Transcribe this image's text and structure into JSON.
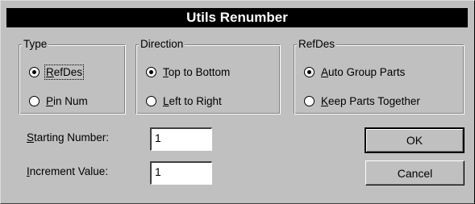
{
  "dialog": {
    "title": "Utils Renumber"
  },
  "type_group": {
    "legend": "Type",
    "options": [
      {
        "pre": "",
        "key": "R",
        "post": "efDes",
        "selected": true
      },
      {
        "pre": "",
        "key": "P",
        "post": "in Num",
        "selected": false
      }
    ]
  },
  "direction_group": {
    "legend": "Direction",
    "options": [
      {
        "pre": "",
        "key": "T",
        "post": "op to Bottom",
        "selected": true
      },
      {
        "pre": "",
        "key": "L",
        "post": "eft to Right",
        "selected": false
      }
    ]
  },
  "refdes_group": {
    "legend": "RefDes",
    "options": [
      {
        "pre": "",
        "key": "A",
        "post": "uto Group Parts",
        "selected": true
      },
      {
        "pre": "",
        "key": "K",
        "post": "eep Parts Together",
        "selected": false
      }
    ]
  },
  "fields": {
    "starting_number": {
      "key": "S",
      "post": "tarting Number:",
      "value": "1"
    },
    "increment_value": {
      "key": "I",
      "post": "ncrement Value:",
      "value": "1"
    }
  },
  "buttons": {
    "ok": "OK",
    "cancel": "Cancel"
  }
}
